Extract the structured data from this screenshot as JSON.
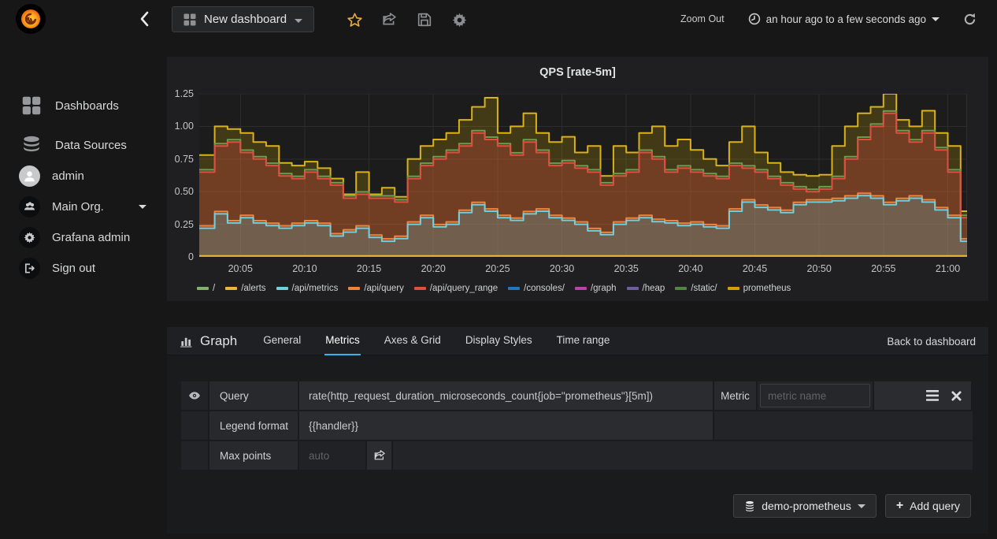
{
  "topbar": {
    "dashboard_title": "New dashboard",
    "zoom_out_label": "Zoom Out",
    "time_range_label": "an hour ago to a few seconds ago"
  },
  "sidebar": {
    "items": [
      {
        "label": "Dashboards"
      },
      {
        "label": "Data Sources"
      }
    ],
    "user_label": "admin",
    "org_label": "Main Org.",
    "admin_label": "Grafana admin",
    "signout_label": "Sign out"
  },
  "panel": {
    "title": "QPS [rate-5m]"
  },
  "chart_data": {
    "type": "area",
    "stacked": true,
    "title": "QPS [rate-5m]",
    "ylim": [
      0,
      1.25
    ],
    "grid": true,
    "legend_position": "bottom",
    "x_domain_minutes": [
      1.8,
      61.5
    ],
    "minutes_start": 2,
    "minutes_step": 1,
    "x_ticks": [
      {
        "m": 5,
        "label": "20:05"
      },
      {
        "m": 10,
        "label": "20:10"
      },
      {
        "m": 15,
        "label": "20:15"
      },
      {
        "m": 20,
        "label": "20:20"
      },
      {
        "m": 25,
        "label": "20:25"
      },
      {
        "m": 30,
        "label": "20:30"
      },
      {
        "m": 35,
        "label": "20:35"
      },
      {
        "m": 40,
        "label": "20:40"
      },
      {
        "m": 45,
        "label": "20:45"
      },
      {
        "m": 50,
        "label": "20:50"
      },
      {
        "m": 55,
        "label": "20:55"
      },
      {
        "m": 60,
        "label": "21:00"
      }
    ],
    "y_ticks": [
      {
        "v": 0,
        "label": "0"
      },
      {
        "v": 0.25,
        "label": "0.25"
      },
      {
        "v": 0.5,
        "label": "0.50"
      },
      {
        "v": 0.75,
        "label": "0.75"
      },
      {
        "v": 1,
        "label": "1.00"
      },
      {
        "v": 1.25,
        "label": "1.25"
      }
    ],
    "values": {
      "api_metrics": [
        0.22,
        0.33,
        0.26,
        0.3,
        0.26,
        0.24,
        0.22,
        0.24,
        0.26,
        0.24,
        0.16,
        0.19,
        0.22,
        0.15,
        0.12,
        0.14,
        0.25,
        0.3,
        0.23,
        0.25,
        0.34,
        0.4,
        0.35,
        0.3,
        0.28,
        0.33,
        0.35,
        0.3,
        0.28,
        0.25,
        0.2,
        0.17,
        0.25,
        0.28,
        0.3,
        0.27,
        0.26,
        0.24,
        0.25,
        0.23,
        0.22,
        0.35,
        0.42,
        0.38,
        0.36,
        0.34,
        0.4,
        0.42,
        0.42,
        0.43,
        0.45,
        0.47,
        0.45,
        0.4,
        0.43,
        0.45,
        0.42,
        0.36,
        0.3,
        0.12
      ],
      "query_range": [
        0.65,
        0.85,
        0.88,
        0.8,
        0.75,
        0.7,
        0.62,
        0.6,
        0.65,
        0.6,
        0.55,
        0.45,
        0.48,
        0.45,
        0.45,
        0.42,
        0.6,
        0.7,
        0.75,
        0.8,
        0.85,
        0.95,
        0.9,
        0.85,
        0.78,
        0.88,
        0.8,
        0.7,
        0.72,
        0.68,
        0.65,
        0.55,
        0.62,
        0.65,
        0.8,
        0.75,
        0.65,
        0.68,
        0.65,
        0.62,
        0.6,
        0.7,
        0.68,
        0.65,
        0.6,
        0.55,
        0.52,
        0.5,
        0.52,
        0.6,
        0.75,
        0.9,
        1.0,
        1.1,
        0.95,
        0.88,
        0.95,
        0.82,
        0.65,
        0.3
      ],
      "total": [
        0.78,
        1.0,
        0.98,
        0.95,
        0.88,
        0.85,
        0.72,
        0.7,
        0.73,
        0.68,
        0.6,
        0.48,
        0.65,
        0.48,
        0.53,
        0.46,
        0.75,
        0.85,
        0.9,
        0.95,
        1.05,
        1.15,
        1.22,
        0.95,
        1.0,
        1.1,
        0.95,
        0.88,
        0.92,
        0.8,
        0.85,
        0.62,
        0.85,
        0.8,
        0.95,
        1.0,
        0.85,
        0.9,
        0.82,
        0.75,
        0.7,
        0.88,
        1.0,
        0.8,
        0.72,
        0.65,
        0.63,
        0.62,
        0.63,
        0.85,
        1.0,
        1.1,
        1.15,
        1.25,
        1.05,
        1.0,
        1.12,
        0.95,
        0.85,
        0.35
      ]
    },
    "layers": [
      {
        "id": "prometheus",
        "kind": "band",
        "values_ref": "total",
        "stroke": "#d9b217",
        "fill": "rgba(204,163,0,0.22)"
      },
      {
        "id": "static",
        "kind": "line",
        "values_ref": "query_range",
        "offset": 0.018,
        "stroke": "#6a9e4f"
      },
      {
        "id": "api_query_range",
        "kind": "band",
        "values_ref": "query_range",
        "stroke": "#e24d42",
        "fill": "rgba(226,77,66,0.30)"
      },
      {
        "id": "api_query",
        "kind": "line",
        "values_ref": "api_metrics",
        "offset": 0.018,
        "stroke": "#ef843c"
      },
      {
        "id": "api_metrics",
        "kind": "band",
        "values_ref": "api_metrics",
        "stroke": "#6ed0e0",
        "fill": "rgba(110,208,224,0.22)"
      },
      {
        "id": "alerts",
        "kind": "line",
        "const": 0.008,
        "stroke": "#EAB839"
      }
    ],
    "legend": [
      {
        "label": "/",
        "color": "#7EB26D"
      },
      {
        "label": "/alerts",
        "color": "#EAB839"
      },
      {
        "label": "/api/metrics",
        "color": "#6ED0E0"
      },
      {
        "label": "/api/query",
        "color": "#EF843C"
      },
      {
        "label": "/api/query_range",
        "color": "#E24D42"
      },
      {
        "label": "/consoles/",
        "color": "#1F78C1"
      },
      {
        "label": "/graph",
        "color": "#BA43A9"
      },
      {
        "label": "/heap",
        "color": "#705DA0"
      },
      {
        "label": "/static/",
        "color": "#508642"
      },
      {
        "label": "prometheus",
        "color": "#CCA300"
      }
    ]
  },
  "editor": {
    "panel_type": "Graph",
    "tabs": [
      "General",
      "Metrics",
      "Axes & Grid",
      "Display Styles",
      "Time range"
    ],
    "back_label": "Back to dashboard",
    "query_label": "Query",
    "query_value": "rate(http_request_duration_microseconds_count{job=\"prometheus\"}[5m])",
    "metric_label": "Metric",
    "metric_placeholder": "metric name",
    "legend_format_label": "Legend format",
    "legend_format_value": "{{handler}}",
    "max_points_label": "Max points",
    "max_points_placeholder": "auto",
    "datasource_label": "demo-prometheus",
    "add_query_label": "Add query"
  }
}
